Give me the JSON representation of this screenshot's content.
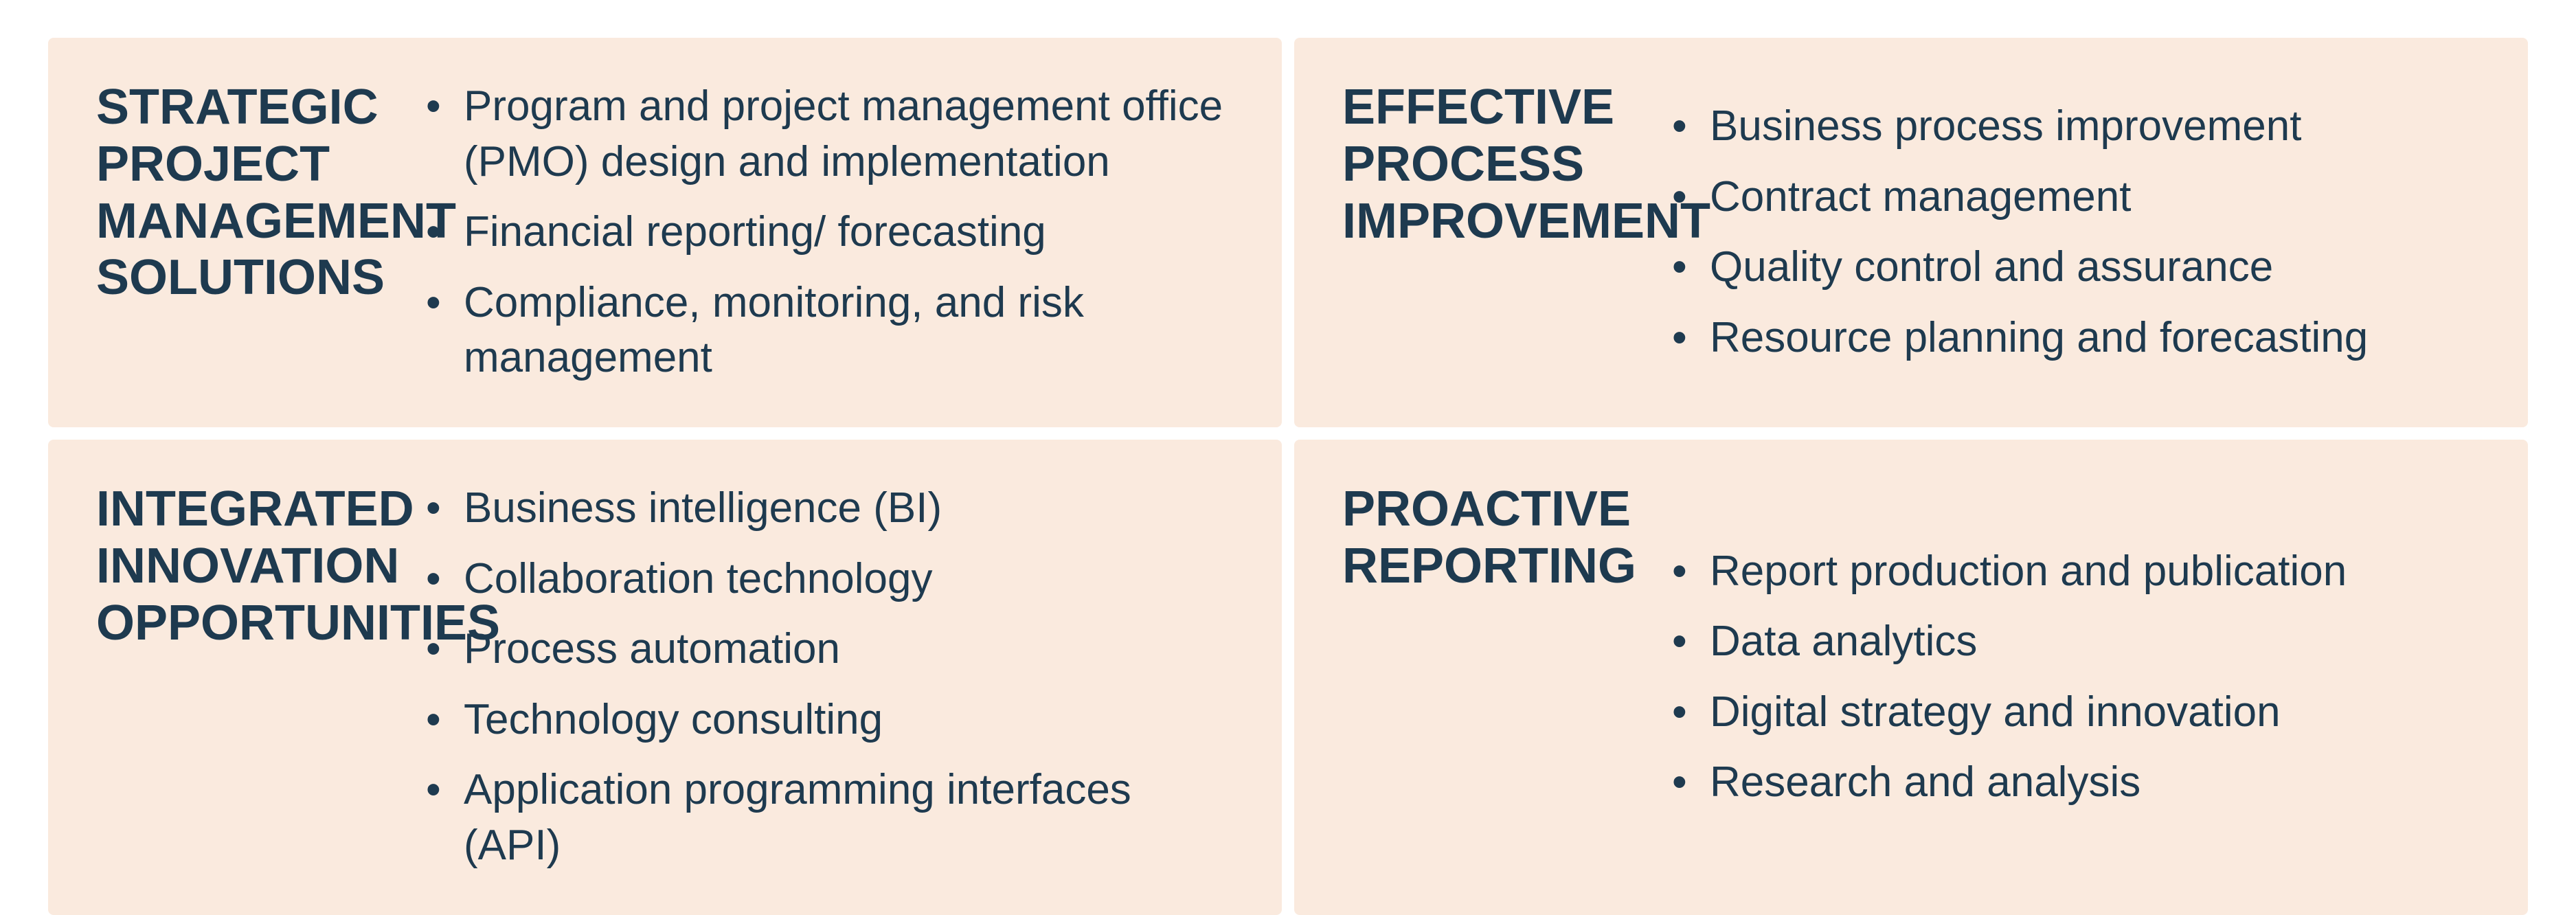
{
  "cards": [
    {
      "id": "strategic-project-management",
      "title": "STRATEGIC PROJECT MANAGEMENT SOLUTIONS",
      "bullets": [
        "Program and project management office (PMO) design and implementation",
        "Financial reporting/ forecasting",
        "Compliance, monitoring, and risk management"
      ]
    },
    {
      "id": "effective-process-improvement",
      "title": "EFFECTIVE PROCESS IMPROVEMENT",
      "bullets": [
        "Business process improvement",
        "Contract management",
        "Quality control and assurance",
        "Resource planning and forecasting"
      ]
    },
    {
      "id": "integrated-innovation",
      "title": "INTEGRATED INNOVATION OPPORTUNITIES",
      "bullets": [
        "Business intelligence (BI)",
        "Collaboration technology",
        "Process automation",
        "Technology consulting",
        "Application programming interfaces (API)"
      ]
    },
    {
      "id": "proactive-reporting",
      "title": "PROACTIVE REPORTING",
      "bullets": [
        "Report production and publication",
        "Data analytics",
        "Digital strategy and innovation",
        "Research and analysis"
      ]
    }
  ]
}
